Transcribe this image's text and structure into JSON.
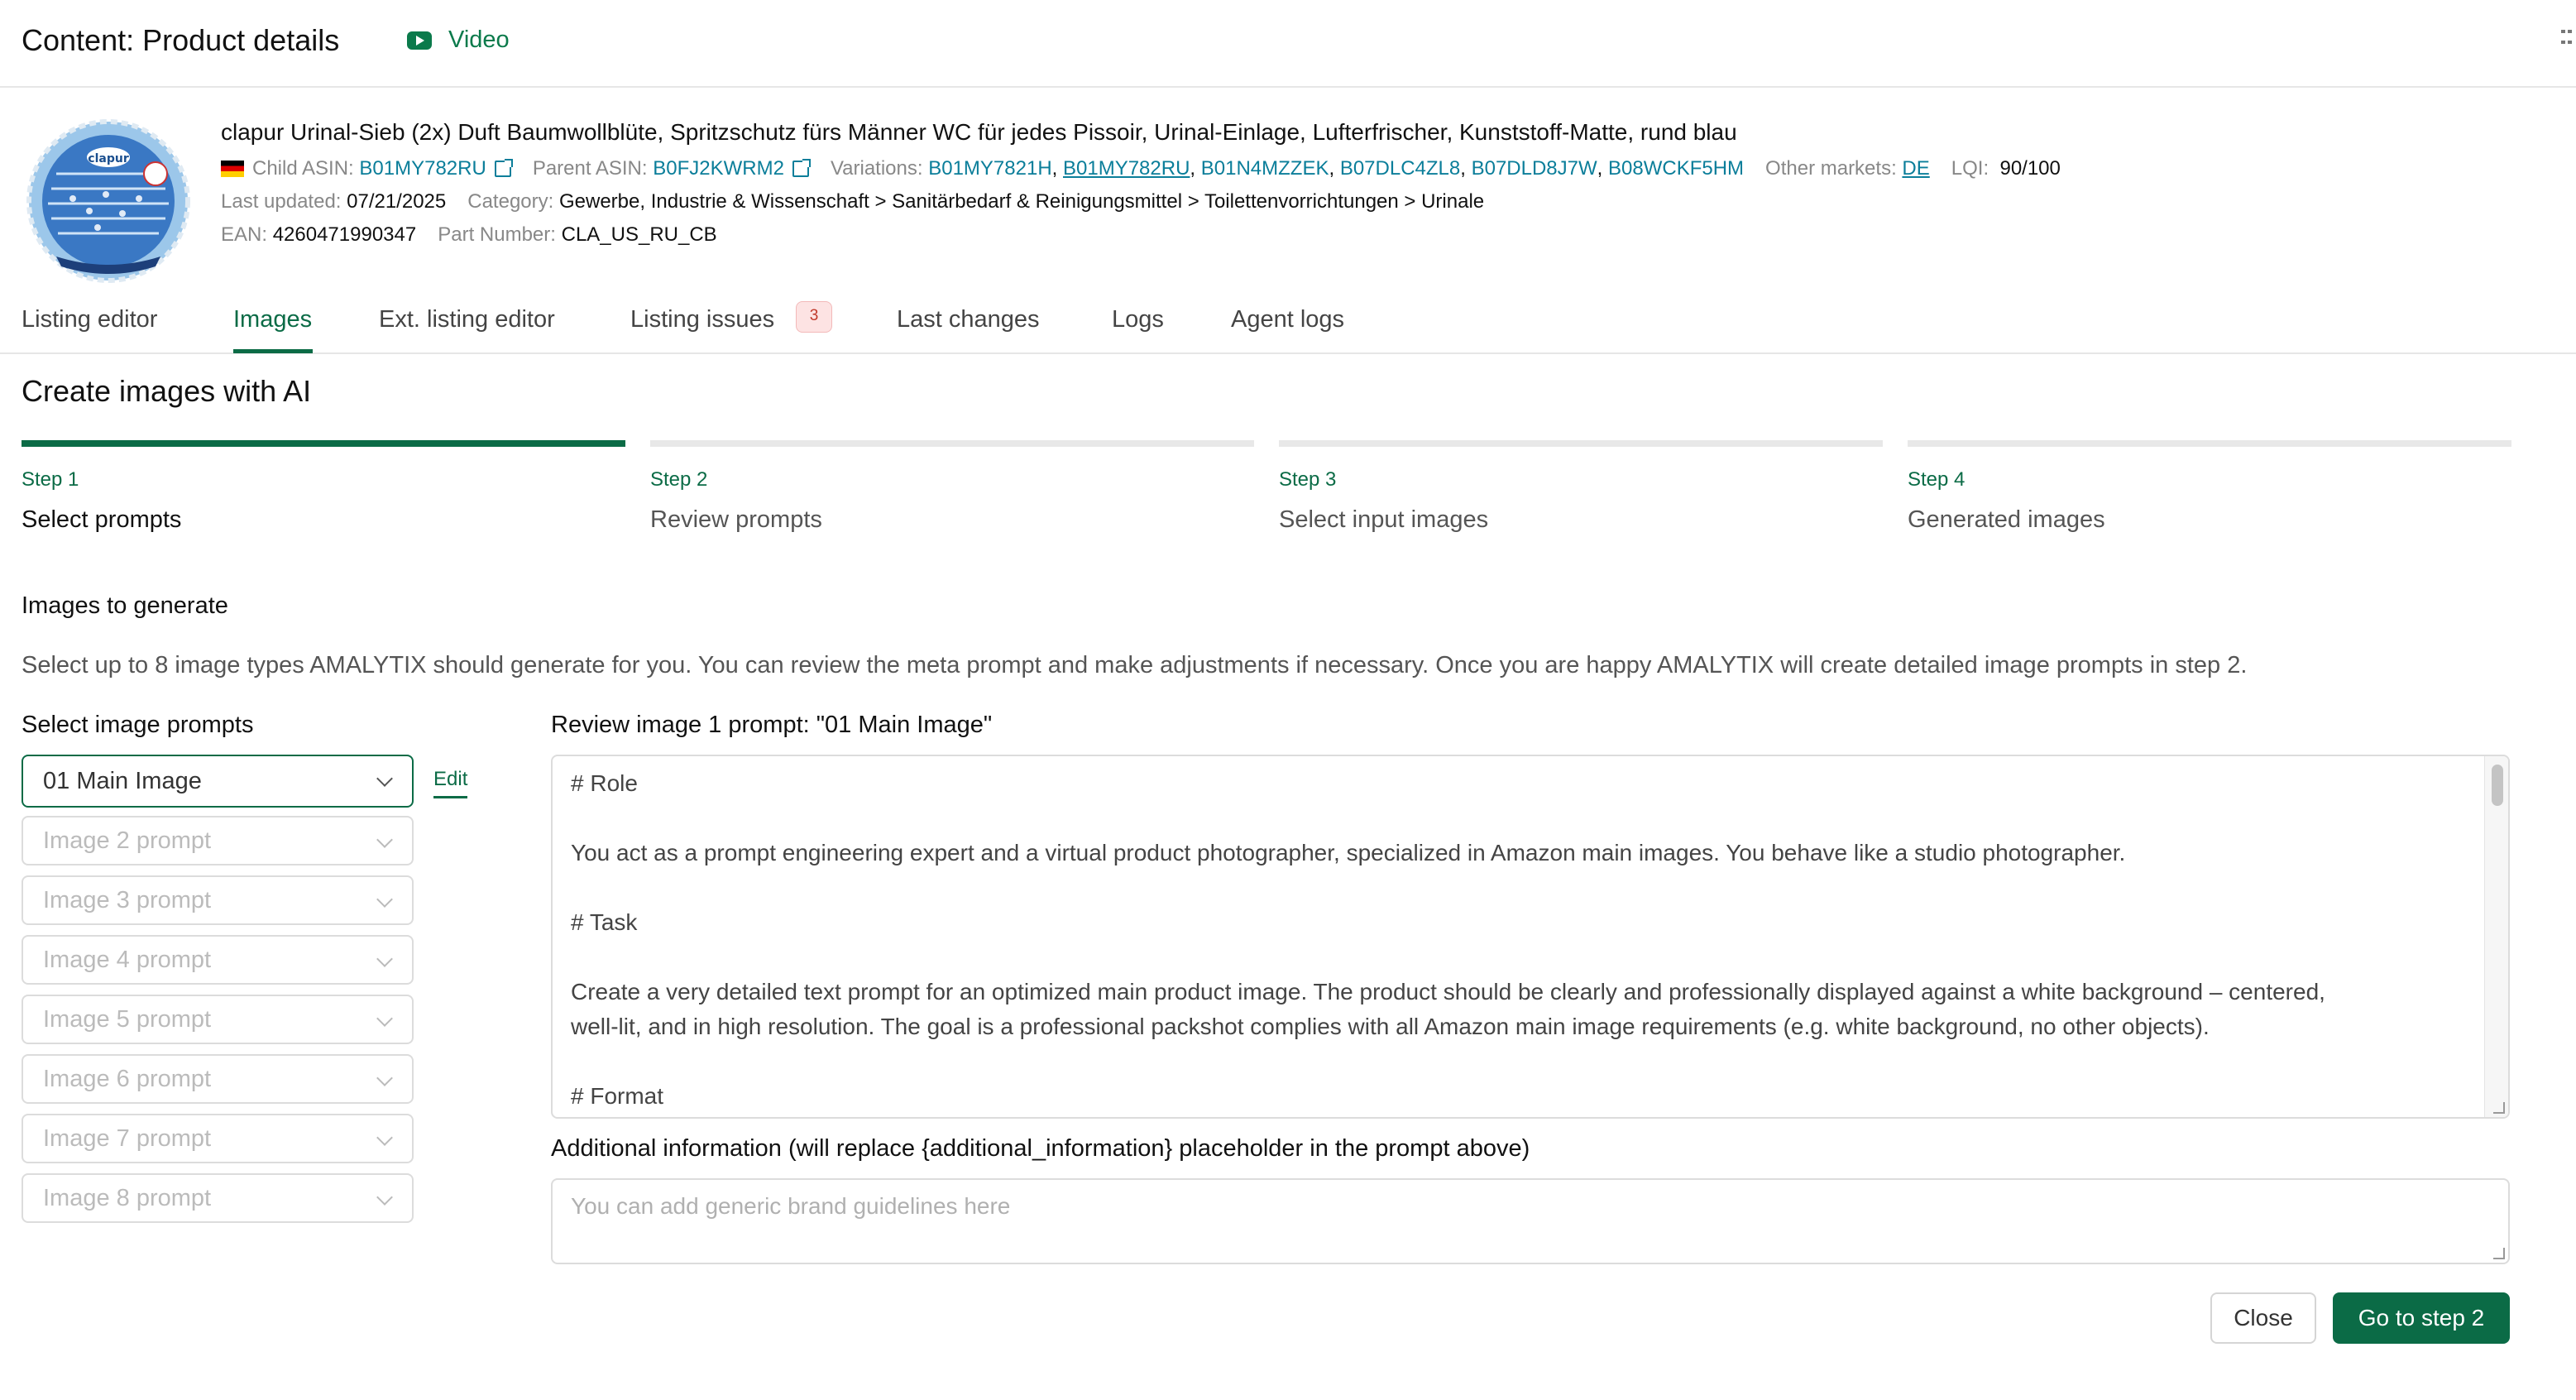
{
  "header": {
    "title": "Content: Product details",
    "video_label": "Video"
  },
  "product": {
    "brand_logo_text": "clapur",
    "title": "clapur Urinal-Sieb (2x) Duft Baumwollblüte, Spritzschutz fürs Männer WC für jedes Pissoir, Urinal-Einlage, Lufterfrischer, Kunststoff-Matte, rund blau",
    "child_asin_label": "Child ASIN:",
    "child_asin": "B01MY782RU",
    "parent_asin_label": "Parent ASIN:",
    "parent_asin": "B0FJ2KWRM2",
    "variations_label": "Variations:",
    "variations": [
      "B01MY7821H",
      "B01MY782RU",
      "B01N4MZZEK",
      "B07DLC4ZL8",
      "B07DLD8J7W",
      "B08WCKF5HM"
    ],
    "other_markets_label": "Other markets:",
    "other_market": "DE",
    "lqi_label": "LQI:",
    "lqi": "90/100",
    "last_updated_label": "Last updated:",
    "last_updated": "07/21/2025",
    "category_label": "Category:",
    "category": "Gewerbe, Industrie & Wissenschaft > Sanitärbedarf & Reinigungsmittel > Toilettenvorrichtungen > Urinale",
    "ean_label": "EAN:",
    "ean": "4260471990347",
    "part_number_label": "Part Number:",
    "part_number": "CLA_US_RU_CB"
  },
  "tabs": [
    {
      "label": "Listing editor"
    },
    {
      "label": "Images",
      "active": true
    },
    {
      "label": "Ext. listing editor"
    },
    {
      "label": "Listing issues",
      "badge": "3"
    },
    {
      "label": "Last changes"
    },
    {
      "label": "Logs"
    },
    {
      "label": "Agent logs"
    }
  ],
  "section": {
    "title": "Create images with AI"
  },
  "steps": [
    {
      "number": "Step 1",
      "label": "Select prompts"
    },
    {
      "number": "Step 2",
      "label": "Review prompts"
    },
    {
      "number": "Step 3",
      "label": "Select input images"
    },
    {
      "number": "Step 4",
      "label": "Generated images"
    }
  ],
  "images_to_generate": {
    "heading": "Images to generate",
    "description": "Select up to 8 image types AMALYTIX should generate for you. You can review the meta prompt and make adjustments if necessary. Once you are happy AMALYTIX will create detailed image prompts in step 2."
  },
  "select_prompts": {
    "heading": "Select image prompts",
    "edit_label": "Edit",
    "options": [
      "01 Main Image",
      "Image 2 prompt",
      "Image 3 prompt",
      "Image 4 prompt",
      "Image 5 prompt",
      "Image 6 prompt",
      "Image 7 prompt",
      "Image 8 prompt"
    ]
  },
  "review": {
    "heading": "Review image 1 prompt: \"01 Main Image\"",
    "prompt_lines": [
      "# Role",
      "",
      "You act as a prompt engineering expert and a virtual product photographer, specialized in Amazon main images. You behave like a studio photographer.",
      "",
      "# Task",
      "",
      "Create a very detailed text prompt for an optimized main product image. The product should be clearly and professionally displayed against a white background – centered,",
      "well-lit, and in high resolution. The goal is a professional packshot complies with all Amazon main image requirements (e.g. white background, no other objects).",
      "",
      "# Format"
    ]
  },
  "additional_info": {
    "heading": "Additional information (will replace {additional_information} placeholder in the prompt above)",
    "placeholder": "You can add generic brand guidelines here"
  },
  "buttons": {
    "close": "Close",
    "next": "Go to step 2"
  }
}
